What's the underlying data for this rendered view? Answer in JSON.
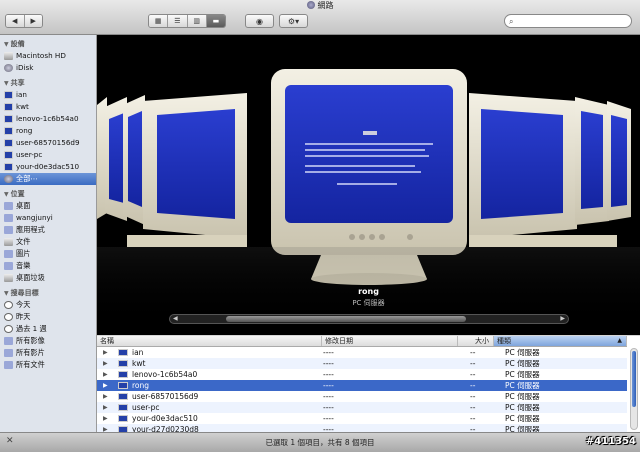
{
  "window": {
    "title": "網路"
  },
  "toolbar": {
    "back_icon": "chevron-left-icon",
    "forward_icon": "chevron-right-icon",
    "view_modes": [
      "icon-view",
      "list-view",
      "column-view",
      "cover-flow-view"
    ],
    "active_view": "cover-flow-view",
    "quicklook_icon": "eye-icon",
    "action_icon": "gear-icon",
    "search": {
      "value": "",
      "placeholder": ""
    }
  },
  "sidebar": {
    "devices": {
      "label": "設備",
      "items": [
        "Macintosh HD",
        "iDisk"
      ]
    },
    "shared": {
      "label": "共享",
      "items": [
        "ian",
        "kwt",
        "lenovo-1c6b54a0",
        "rong",
        "user-68570156d9",
        "user-pc",
        "your-d0e3dac510",
        "全部⋯"
      ],
      "selected": "全部⋯"
    },
    "places": {
      "label": "位置",
      "items": [
        "桌面",
        "wangjunyi",
        "應用程式",
        "文件",
        "圖片",
        "音樂",
        "桌面垃圾"
      ]
    },
    "search_for": {
      "label": "搜尋目標",
      "items": [
        "今天",
        "昨天",
        "過去 1 週",
        "所有影像",
        "所有影片",
        "所有文件"
      ]
    }
  },
  "coverflow": {
    "name": "rong",
    "kind": "PC 伺服器"
  },
  "list": {
    "columns": [
      "名稱",
      "修改日期",
      "大小",
      "種類"
    ],
    "sorted_column": "種類",
    "rows": [
      {
        "name": "ian",
        "date": "----",
        "size": "--",
        "kind": "PC 伺服器"
      },
      {
        "name": "kwt",
        "date": "----",
        "size": "--",
        "kind": "PC 伺服器"
      },
      {
        "name": "lenovo-1c6b54a0",
        "date": "----",
        "size": "--",
        "kind": "PC 伺服器"
      },
      {
        "name": "rong",
        "date": "----",
        "size": "--",
        "kind": "PC 伺服器"
      },
      {
        "name": "user-68570156d9",
        "date": "----",
        "size": "--",
        "kind": "PC 伺服器"
      },
      {
        "name": "user-pc",
        "date": "----",
        "size": "--",
        "kind": "PC 伺服器"
      },
      {
        "name": "your-d0e3dac510",
        "date": "----",
        "size": "--",
        "kind": "PC 伺服器"
      },
      {
        "name": "your-d27d0230d8",
        "date": "----",
        "size": "--",
        "kind": "PC 伺服器"
      }
    ],
    "selected_row": "rong"
  },
  "status": {
    "text": "已選取 1 個項目，共有 8 個項目"
  },
  "watermark": "#411354",
  "colors": {
    "selection": "#3b68c8",
    "screen_blue": "#1c2fb4",
    "sidebar_bg": "#dfe4ec"
  }
}
